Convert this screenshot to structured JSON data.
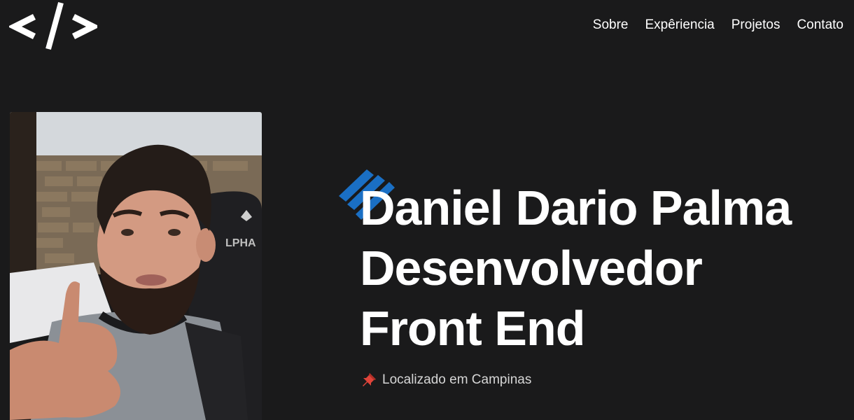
{
  "header": {
    "logo_icon": "code-brackets-icon",
    "nav": [
      {
        "label": "Sobre"
      },
      {
        "label": "Expêriencia"
      },
      {
        "label": "Projetos"
      },
      {
        "label": "Contato"
      }
    ]
  },
  "hero": {
    "photo_icon": "profile-photo",
    "title_lines": [
      "Daniel Dario Palma",
      "Desenvolvedor",
      "Front End"
    ],
    "accent_color": "#1a6fc4",
    "location_icon": "pushpin-icon",
    "location": "Localizado em Campinas"
  },
  "colors": {
    "background": "#1a1a1b",
    "text": "#ffffff",
    "muted_text": "#d6d6d6"
  }
}
